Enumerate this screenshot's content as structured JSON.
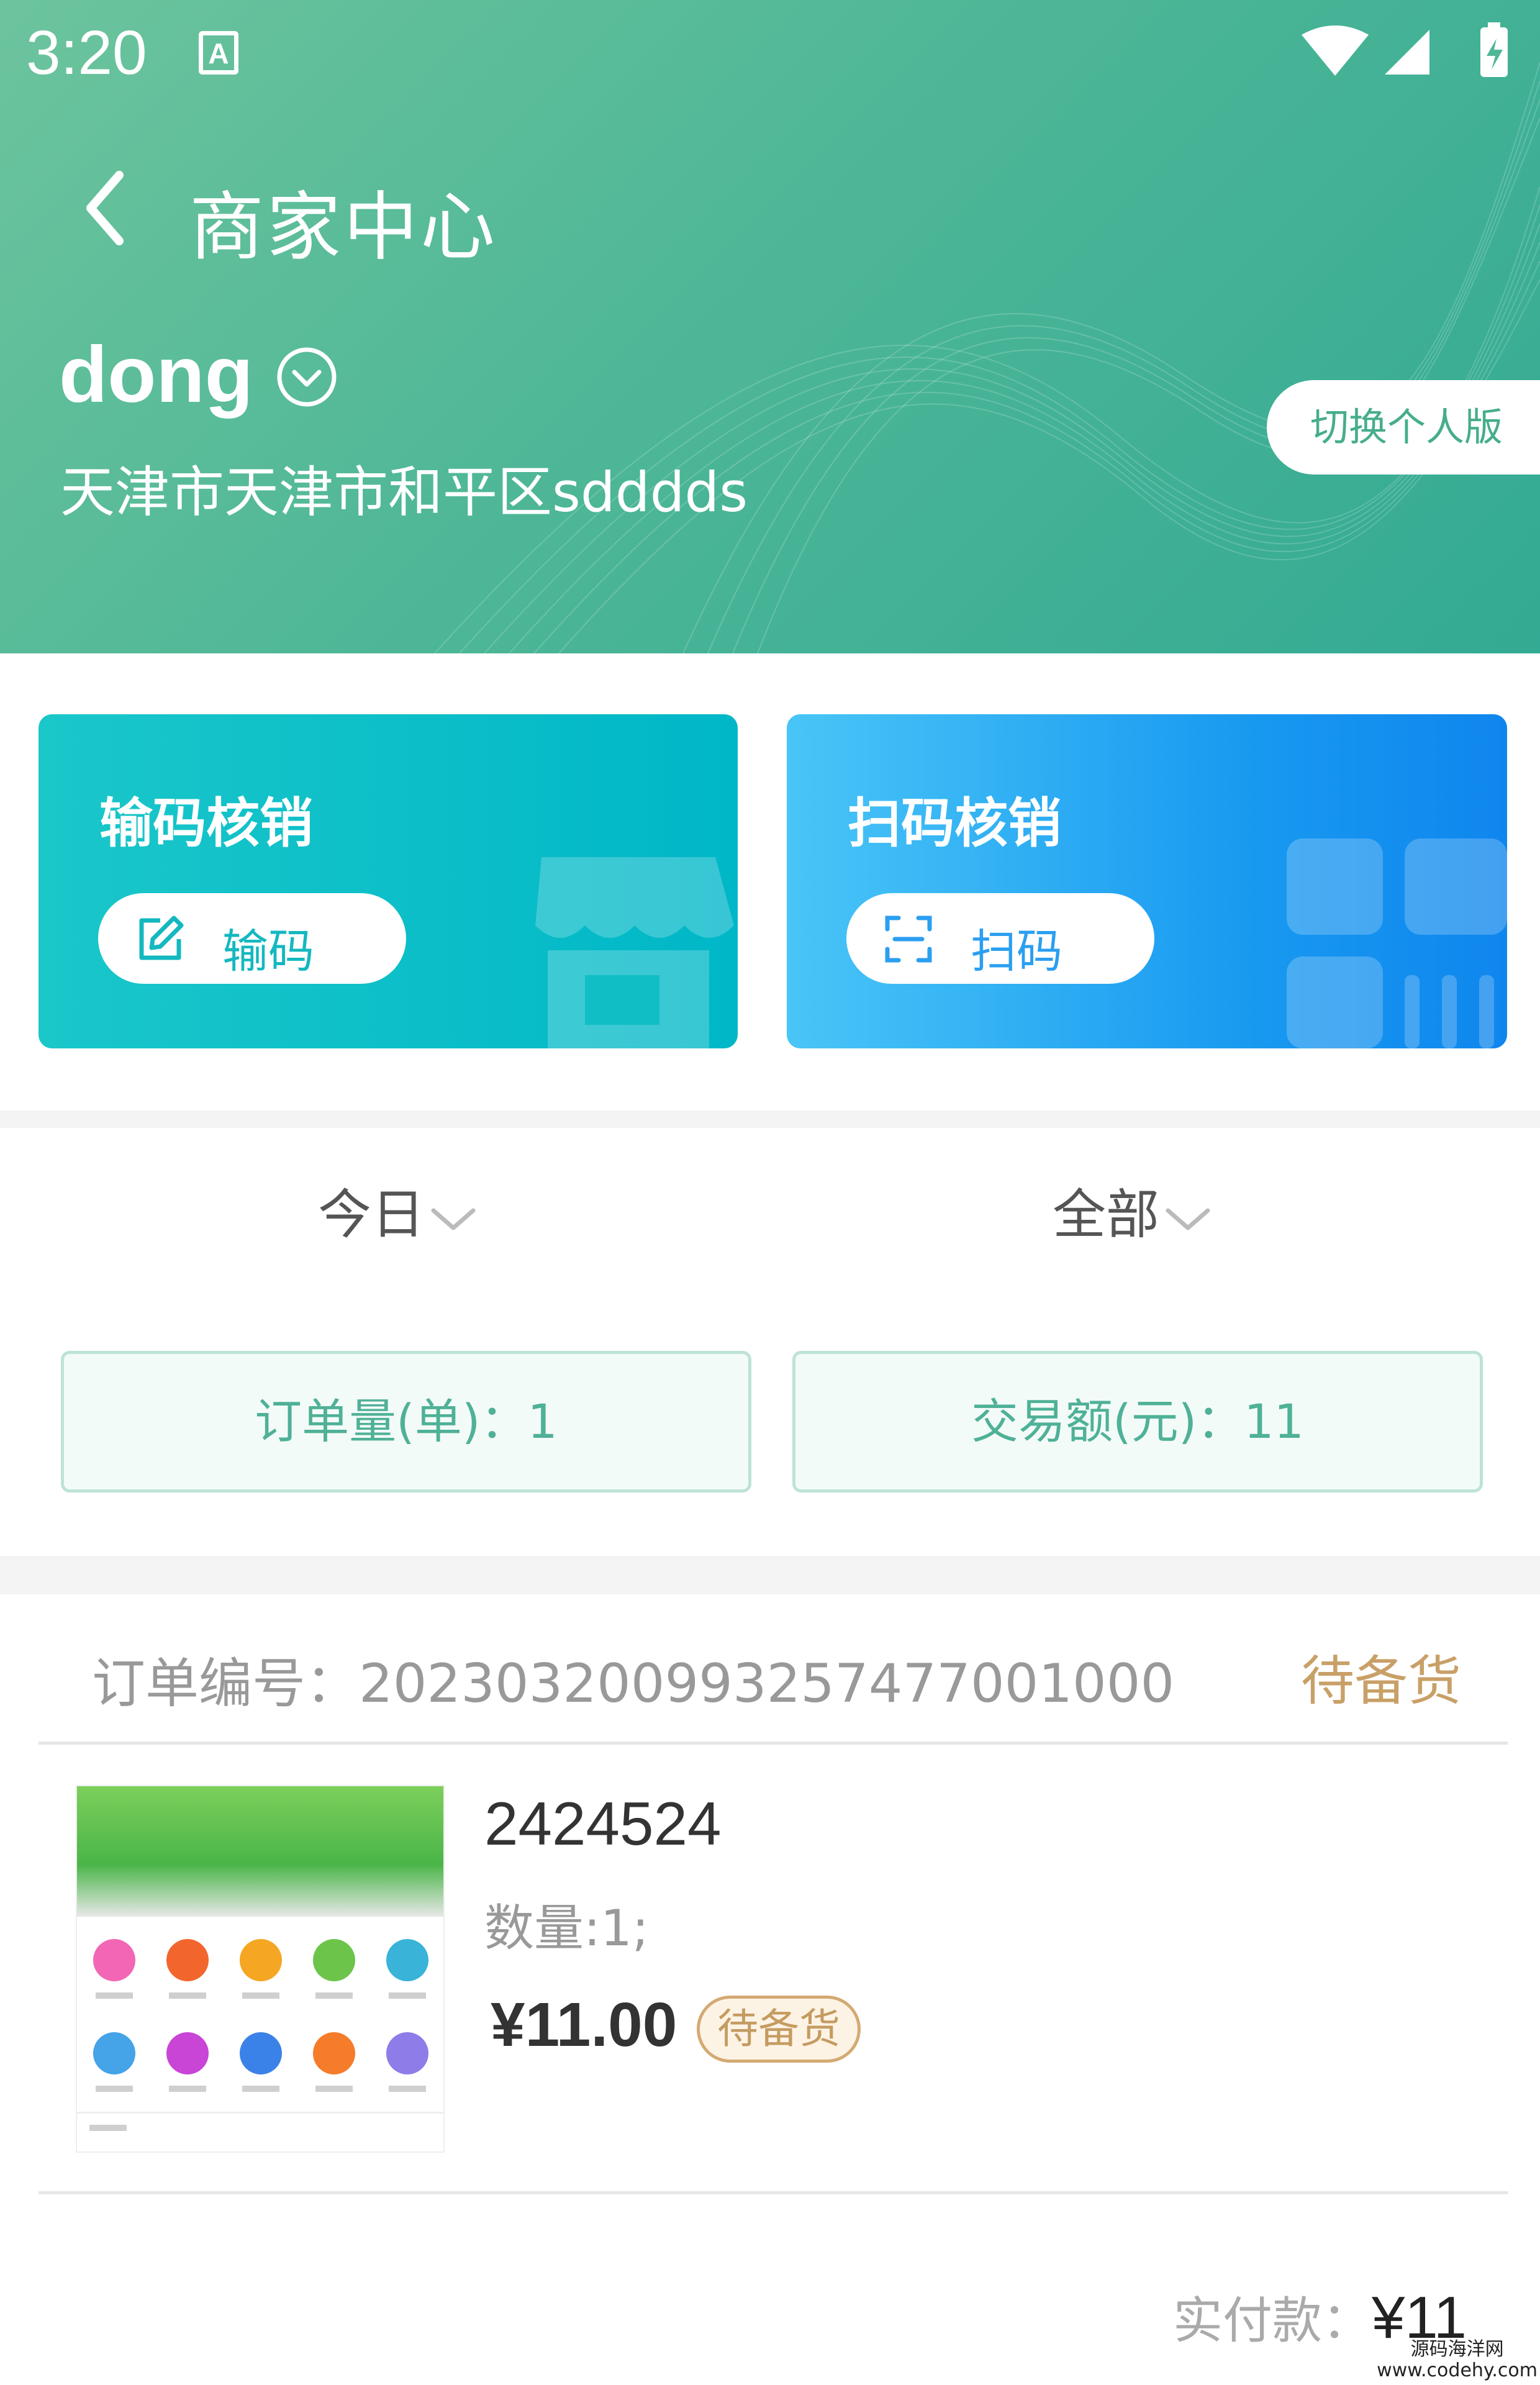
{
  "status_bar": {
    "time": "3:20",
    "notification": "A"
  },
  "header": {
    "title": "商家中心",
    "merchant_name": "dong",
    "address": "天津市天津市和平区sdddds",
    "switch_label": "切换个人版"
  },
  "actions": {
    "input_verify": {
      "title": "输码核销",
      "button": "输码"
    },
    "scan_verify": {
      "title": "扫码核销",
      "button": "扫码"
    }
  },
  "filters": {
    "date": "今日",
    "type": "全部"
  },
  "stats": {
    "orders": "订单量(单)：1",
    "amount": "交易额(元)：11"
  },
  "order": {
    "number_label": "订单编号：2023032009932574770010​00",
    "status": "待备货",
    "product": {
      "name": "2424524",
      "quantity": "数量:1;",
      "price": "¥11.00",
      "badge": "待备货"
    },
    "paid_label": "实付款：",
    "paid_amount": "¥11"
  },
  "watermark": {
    "line1": "源码海洋网",
    "line2": "www.codehy.com"
  },
  "colors": {
    "header": "#4fb797",
    "accent_teal": "#14b8c0",
    "accent_blue": "#2b9ff0",
    "status_gold": "#c8a067"
  }
}
